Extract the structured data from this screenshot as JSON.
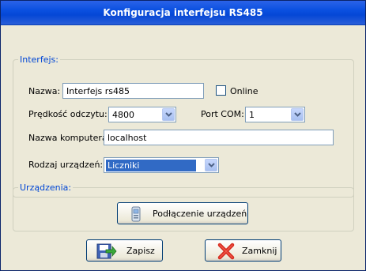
{
  "window": {
    "title": "Konfiguracja interfejsu RS485"
  },
  "interfejs": {
    "legend": "Interfejs:",
    "nazwa_label": "Nazwa:",
    "nazwa_value": "Interfejs rs485",
    "online_label": "Online",
    "online_checked": false,
    "predkosc_label": "Prędkość odczytu:",
    "predkosc_value": "4800",
    "port_label": "Port COM:",
    "port_value": "1",
    "komputer_label": "Nazwa komputera:",
    "komputer_value": "localhost",
    "rodzaj_label": "Rodzaj urządzeń:",
    "rodzaj_value": "Liczniki"
  },
  "urzadzenia": {
    "legend": "Urządzenia:",
    "connect_button": "Podłączenie urządzeń"
  },
  "footer": {
    "save_button": "Zapisz",
    "close_button": "Zamknij"
  },
  "colors": {
    "title_bar": "#0a50e0",
    "legend_text": "#0046d5",
    "selection": "#316ac5"
  },
  "icons": [
    "devices-icon",
    "save-icon",
    "close-x-icon",
    "chevron-down-icon"
  ]
}
